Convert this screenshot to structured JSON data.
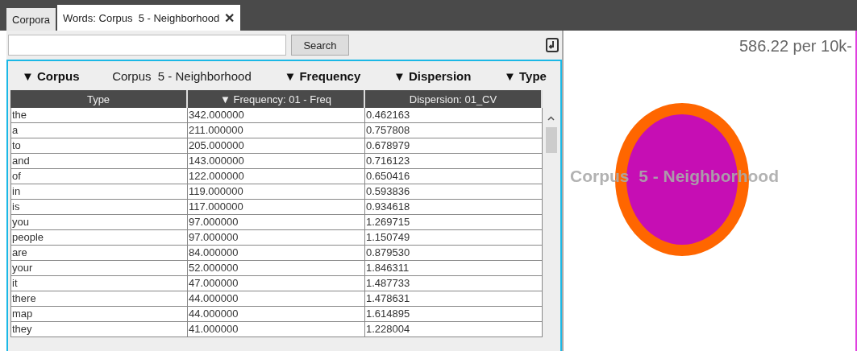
{
  "tabs": [
    {
      "label": "Corpora",
      "selected": false
    },
    {
      "label": "Words: Corpus  5 - Neighborhood",
      "selected": true,
      "close_icon": "✕"
    }
  ],
  "search": {
    "button": "Search"
  },
  "filters": [
    {
      "label": "Corpus",
      "value": "Corpus  5 - Neighborhood"
    },
    {
      "label": "Frequency"
    },
    {
      "label": "Dispersion"
    },
    {
      "label": "Type"
    }
  ],
  "filter_marker": "▼",
  "table": {
    "columns": [
      {
        "label": "Type",
        "sorted": false
      },
      {
        "label": "Frequency: 01 - Freq",
        "sorted": true
      },
      {
        "label": "Dispersion: 01_CV",
        "sorted": false
      }
    ],
    "rows": [
      [
        "the",
        "342.000000",
        "0.462163"
      ],
      [
        "a",
        "211.000000",
        "0.757808"
      ],
      [
        "to",
        "205.000000",
        "0.678979"
      ],
      [
        "and",
        "143.000000",
        "0.716123"
      ],
      [
        "of",
        "122.000000",
        "0.650416"
      ],
      [
        "in",
        "119.000000",
        "0.593836"
      ],
      [
        "is",
        "117.000000",
        "0.934618"
      ],
      [
        "you",
        "97.000000",
        "1.269715"
      ],
      [
        "people",
        "97.000000",
        "1.150749"
      ],
      [
        "are",
        "84.000000",
        "0.879530"
      ],
      [
        "your",
        "52.000000",
        "1.846311"
      ],
      [
        "it",
        "47.000000",
        "1.487733"
      ],
      [
        "there",
        "44.000000",
        "1.478631"
      ],
      [
        "map",
        "44.000000",
        "1.614895"
      ],
      [
        "they",
        "41.000000",
        "1.228004"
      ]
    ]
  },
  "visual": {
    "scale_label": "586.22 per 10k-",
    "bubble_label": "Corpus  5 - Neighborhood"
  }
}
